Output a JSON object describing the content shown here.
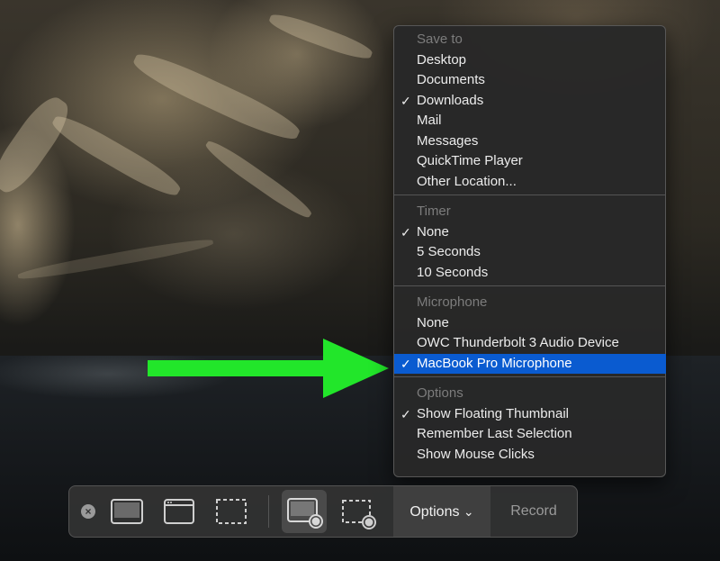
{
  "menu": {
    "sections": [
      {
        "header": "Save to",
        "items": [
          {
            "label": "Desktop",
            "checked": false
          },
          {
            "label": "Documents",
            "checked": false
          },
          {
            "label": "Downloads",
            "checked": true
          },
          {
            "label": "Mail",
            "checked": false
          },
          {
            "label": "Messages",
            "checked": false
          },
          {
            "label": "QuickTime Player",
            "checked": false
          },
          {
            "label": "Other Location...",
            "checked": false
          }
        ]
      },
      {
        "header": "Timer",
        "items": [
          {
            "label": "None",
            "checked": true
          },
          {
            "label": "5 Seconds",
            "checked": false
          },
          {
            "label": "10 Seconds",
            "checked": false
          }
        ]
      },
      {
        "header": "Microphone",
        "items": [
          {
            "label": "None",
            "checked": false
          },
          {
            "label": "OWC Thunderbolt 3 Audio Device",
            "checked": false
          },
          {
            "label": "MacBook Pro Microphone",
            "checked": true,
            "highlighted": true
          }
        ]
      },
      {
        "header": "Options",
        "items": [
          {
            "label": "Show Floating Thumbnail",
            "checked": true
          },
          {
            "label": "Remember Last Selection",
            "checked": false
          },
          {
            "label": "Show Mouse Clicks",
            "checked": false
          }
        ]
      }
    ],
    "check_glyph": "✓",
    "highlight_color": "#0a5bd0"
  },
  "toolbar": {
    "close_glyph": "×",
    "tools": [
      {
        "name": "capture-entire-screen-icon"
      },
      {
        "name": "capture-window-icon"
      },
      {
        "name": "capture-selection-icon"
      },
      {
        "name": "record-entire-screen-icon",
        "active": true
      },
      {
        "name": "record-selection-icon"
      }
    ],
    "options_label": "Options",
    "options_chevron": "⌄",
    "record_label": "Record"
  },
  "annotation": {
    "arrow_color": "#22e62a"
  }
}
